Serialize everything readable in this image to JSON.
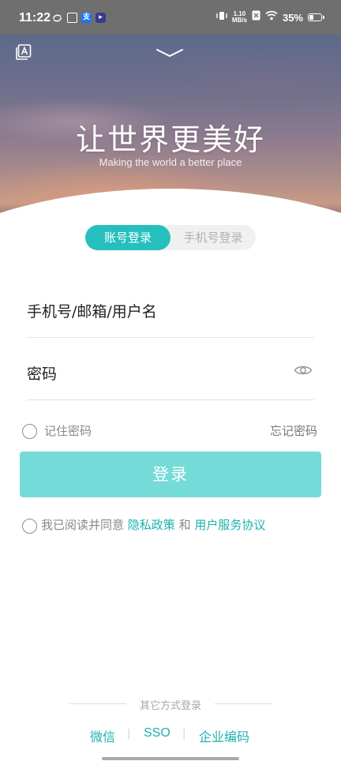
{
  "status_bar": {
    "time": "11:22",
    "net_speed_value": "1.10",
    "net_speed_unit": "MB/s",
    "battery_percent": "35%",
    "battery_level": 0.35
  },
  "hero": {
    "title": "让世界更美好",
    "subtitle": "Making the world a better place"
  },
  "tabs": [
    {
      "label": "账号登录",
      "active": true
    },
    {
      "label": "手机号登录",
      "active": false
    }
  ],
  "form": {
    "username_placeholder": "手机号/邮箱/用户名",
    "password_placeholder": "密码"
  },
  "remember_label": "记住密码",
  "forgot_label": "忘记密码",
  "login_button_label": "登录",
  "agreement": {
    "prefix": "我已阅读并同意",
    "privacy_link": "隐私政策",
    "conjunction": "和",
    "terms_link": "用户服务协议"
  },
  "other_login": {
    "label": "其它方式登录",
    "options": [
      "微信",
      "SSO",
      "企业编码"
    ],
    "separator": "|"
  },
  "colors": {
    "accent": "#25c0bd",
    "login_button": "#74dbd8",
    "link": "#1fb0ad"
  }
}
